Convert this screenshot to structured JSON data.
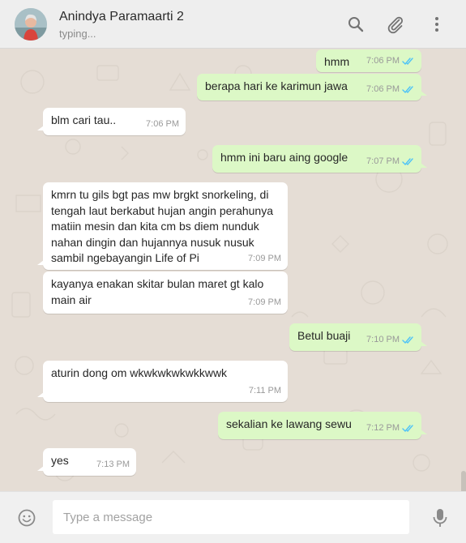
{
  "header": {
    "contact_name": "Anindya Paramaarti 2",
    "status": "typing...",
    "icons": [
      "search-icon",
      "attach-icon",
      "menu-icon"
    ]
  },
  "messages": [
    {
      "direction": "out",
      "text": "hmm",
      "time": "7:06 PM",
      "read": true
    },
    {
      "direction": "out",
      "text": "berapa hari ke karimun jawa",
      "time": "7:06 PM",
      "read": true
    },
    {
      "direction": "in",
      "text": "blm cari tau..",
      "time": "7:06 PM"
    },
    {
      "direction": "out",
      "text": "hmm ini baru aing google",
      "time": "7:07 PM",
      "read": true
    },
    {
      "direction": "in",
      "text": "kmrn tu gils bgt pas mw brgkt snorkeling, di\ntengah laut berkabut hujan angin perahunya\nmatiin mesin dan kita cm bs diem nunduk\nnahan dingin dan hujannya nusuk nusuk\nsambil ngebayangin Life of Pi",
      "time": "7:09 PM"
    },
    {
      "direction": "in",
      "text": "kayanya enakan skitar bulan maret gt kalo\nmain air",
      "time": "7:09 PM"
    },
    {
      "direction": "out",
      "text": "Betul buaji",
      "time": "7:10 PM",
      "read": true
    },
    {
      "direction": "in",
      "text": "aturin dong om wkwkwkwkwkkwwk",
      "time": "7:11 PM"
    },
    {
      "direction": "out",
      "text": "sekalian ke lawang sewu",
      "time": "7:12 PM",
      "read": true
    },
    {
      "direction": "in",
      "text": "yes",
      "time": "7:13 PM"
    }
  ],
  "composer": {
    "placeholder": "Type a message",
    "value": ""
  },
  "colors": {
    "chat_background": "#e5ddd5",
    "outgoing_bubble": "#dcf8c6",
    "incoming_bubble": "#ffffff",
    "read_ticks": "#4fc3f7",
    "header_background": "#eeeeee"
  }
}
